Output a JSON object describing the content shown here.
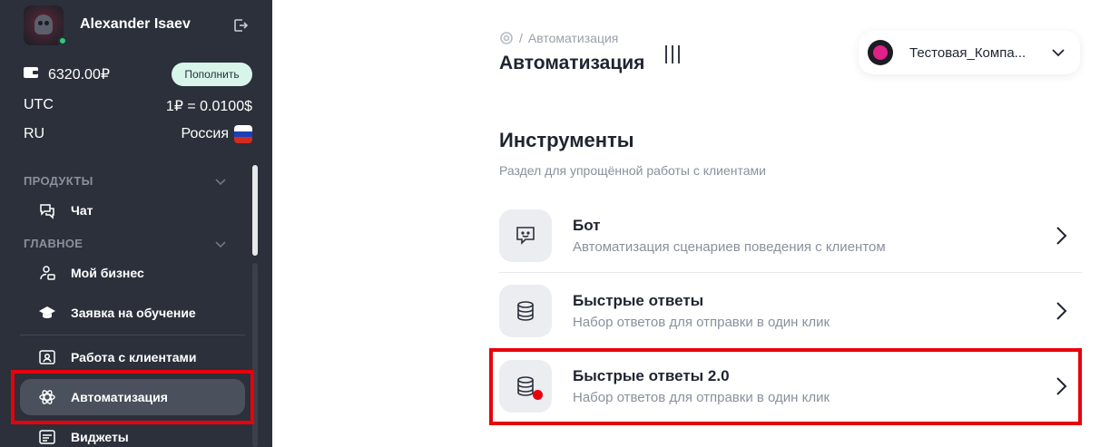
{
  "user": {
    "name": "Alexander Isaev"
  },
  "wallet": {
    "balance": "6320.00₽",
    "topup_label": "Пополнить"
  },
  "info": {
    "timezone": "UTC",
    "rate": "1₽ = 0.0100$",
    "lang": "RU",
    "country": "Россия"
  },
  "sections": {
    "products": "ПРОДУКТЫ",
    "main": "ГЛАВНОЕ"
  },
  "nav": {
    "chat": "Чат",
    "my_business": "Мой бизнес",
    "training": "Заявка на обучение",
    "clients": "Работа с клиентами",
    "automation": "Автоматизация",
    "widgets": "Виджеты"
  },
  "breadcrumb": {
    "separator": "/",
    "current": "Автоматизация"
  },
  "page": {
    "title": "Автоматизация"
  },
  "company": {
    "name": "Тестовая_Компа..."
  },
  "tools_section": {
    "title": "Инструменты",
    "subtitle": "Раздел для упрощённой работы с клиентами",
    "items": [
      {
        "name": "Бот",
        "desc": "Автоматизация сценариев поведения с клиентом",
        "icon": "bot-chat-icon"
      },
      {
        "name": "Быстрые ответы",
        "desc": "Набор ответов для отправки в один клик",
        "icon": "database-icon"
      },
      {
        "name": "Быстрые ответы 2.0",
        "desc": "Набор ответов для отправки в один клик",
        "icon": "database-icon"
      }
    ]
  },
  "colors": {
    "sidebar_bg": "#2b303b",
    "active_item": "#4a505c",
    "accent_green": "#d7f5e9",
    "highlight_red": "#e8000b",
    "online": "#2ecc71"
  }
}
